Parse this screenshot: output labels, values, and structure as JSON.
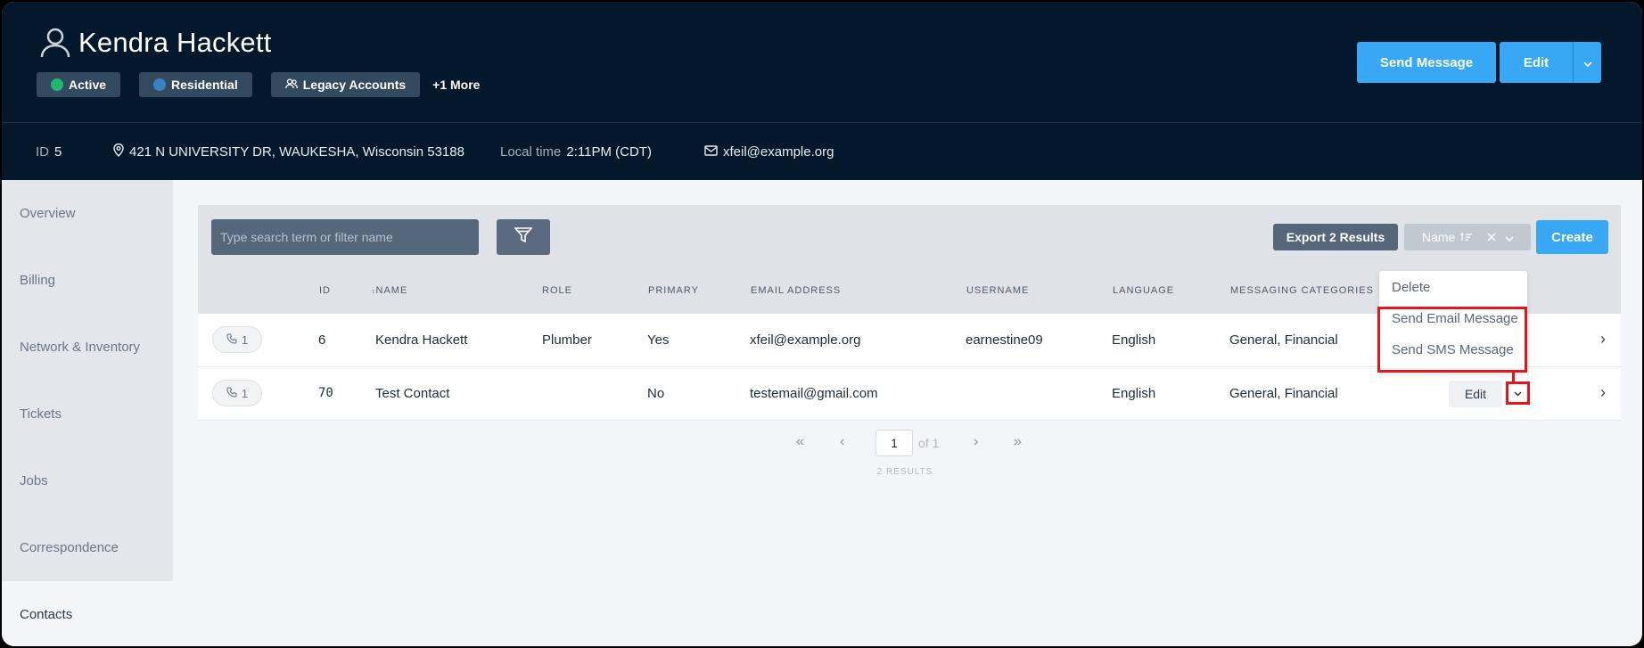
{
  "header": {
    "title": "Kendra Hackett",
    "tags": [
      {
        "label": "Active",
        "color": "#22b573"
      },
      {
        "label": "Residential",
        "color": "#3b82c4"
      },
      {
        "label": "Legacy Accounts"
      }
    ],
    "more_label": "+1 More",
    "send_message_label": "Send Message",
    "edit_label": "Edit"
  },
  "info": {
    "id_label": "ID",
    "id_value": "5",
    "address": "421 N UNIVERSITY DR, WAUKESHA, Wisconsin 53188",
    "local_time_label": "Local time",
    "local_time_value": "2:11PM (CDT)",
    "email": "xfeil@example.org"
  },
  "sidebar": {
    "items": [
      {
        "label": "Overview"
      },
      {
        "label": "Billing"
      },
      {
        "label": "Network & Inventory"
      },
      {
        "label": "Tickets"
      },
      {
        "label": "Jobs"
      },
      {
        "label": "Correspondence"
      },
      {
        "label": "Contacts",
        "active": true
      }
    ]
  },
  "toolbar": {
    "search_placeholder": "Type search term or filter name",
    "export_label": "Export 2 Results",
    "sort_label": "Name",
    "create_label": "Create"
  },
  "table": {
    "columns": [
      "ID",
      "Name",
      "Role",
      "Primary",
      "Email Address",
      "Username",
      "Language",
      "Messaging Categories"
    ],
    "rows": [
      {
        "phone_count": "1",
        "id": "6",
        "name": "Kendra Hackett",
        "role": "Plumber",
        "primary": "Yes",
        "email": "xfeil@example.org",
        "username": "earnestine09",
        "language": "English",
        "categories": "General, Financial"
      },
      {
        "phone_count": "1",
        "id": "70",
        "name": "Test Contact",
        "role": "",
        "primary": "No",
        "email": "testemail@gmail.com",
        "username": "",
        "language": "English",
        "categories": "General, Financial",
        "edit_label": "Edit"
      }
    ]
  },
  "dropdown": {
    "items": [
      "Delete",
      "Send Email Message",
      "Send SMS Message"
    ]
  },
  "pagination": {
    "page": "1",
    "of_label": "of 1",
    "results_label": "2 RESULTS"
  },
  "colors": {
    "header_bg": "#04182b",
    "accent": "#38a8f5",
    "highlight": "#e5161b"
  }
}
